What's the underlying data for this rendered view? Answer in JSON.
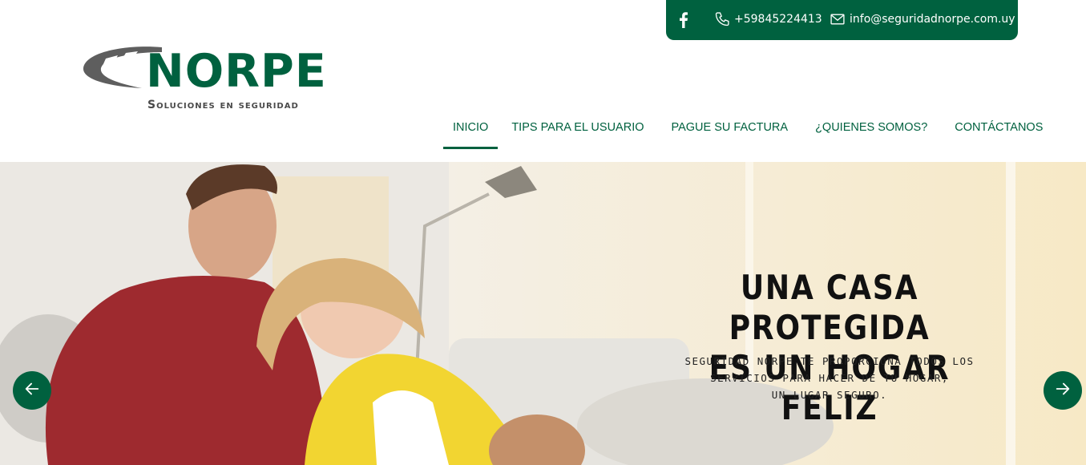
{
  "contact": {
    "facebook_icon": "facebook-icon",
    "phone": "+59845224413",
    "email": "info@seguridadnorpe.com.uy"
  },
  "logo": {
    "name": "NORPE",
    "tagline": "Soluciones en seguridad"
  },
  "nav": {
    "items": [
      {
        "label": "INICIO",
        "active": true
      },
      {
        "label": "TIPS PARA EL USUARIO"
      },
      {
        "label": "PAGUE SU FACTURA"
      },
      {
        "label": "¿QUIENES SOMOS?"
      },
      {
        "label": "CONTÁCTANOS"
      }
    ]
  },
  "hero": {
    "title_line1": "UNA CASA PROTEGIDA",
    "title_line2": "ES UN HOGAR FELIZ",
    "subtitle": "SEGURIDAD NORPE TE PROPORCIONA TODOS LOS\nSERVICIOS PARA HACER DE TU HOGAR,\nUN LUGAR SEGURO.",
    "prev_icon": "arrow-left-icon",
    "next_icon": "arrow-right-icon"
  },
  "colors": {
    "brand_green": "#00613f",
    "logo_gray": "#4a4a4a"
  }
}
